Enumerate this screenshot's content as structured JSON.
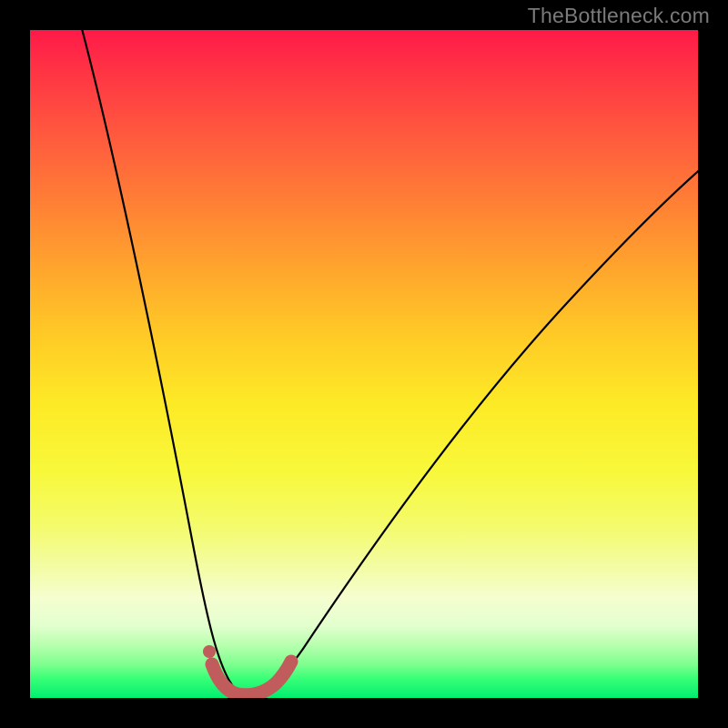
{
  "watermark": "TheBottleneck.com",
  "colors": {
    "curve_stroke": "#000000",
    "highlight_stroke": "#c15c5c",
    "highlight_dot": "#c15c5c",
    "frame": "#000000"
  },
  "chart_data": {
    "type": "line",
    "title": "",
    "xlabel": "",
    "ylabel": "",
    "xlim": [
      0,
      100
    ],
    "ylim": [
      0,
      100
    ],
    "series": [
      {
        "name": "bottleneck-curve-left",
        "x": [
          0,
          3,
          6,
          9,
          12,
          15,
          18,
          20,
          22,
          24,
          26,
          27,
          28,
          29,
          30,
          31
        ],
        "values": [
          110,
          98,
          85,
          72,
          60,
          47,
          35,
          27,
          20,
          13,
          7,
          5,
          3,
          1.5,
          0.5,
          0
        ]
      },
      {
        "name": "bottleneck-curve-right",
        "x": [
          31,
          33,
          35,
          37,
          40,
          45,
          50,
          55,
          60,
          65,
          70,
          75,
          80,
          85,
          90,
          95,
          100
        ],
        "values": [
          0,
          1,
          3,
          5,
          9,
          16,
          23,
          29,
          35,
          41,
          46,
          51,
          56,
          60,
          64,
          68,
          71
        ]
      },
      {
        "name": "optimal-range-highlight",
        "x": [
          27,
          28,
          30,
          32,
          34,
          36,
          37
        ],
        "values": [
          4,
          1.5,
          0.3,
          0,
          0.5,
          2,
          4
        ]
      }
    ],
    "annotations": [
      {
        "name": "optimal-dot",
        "x": 27,
        "y": 6
      }
    ]
  }
}
